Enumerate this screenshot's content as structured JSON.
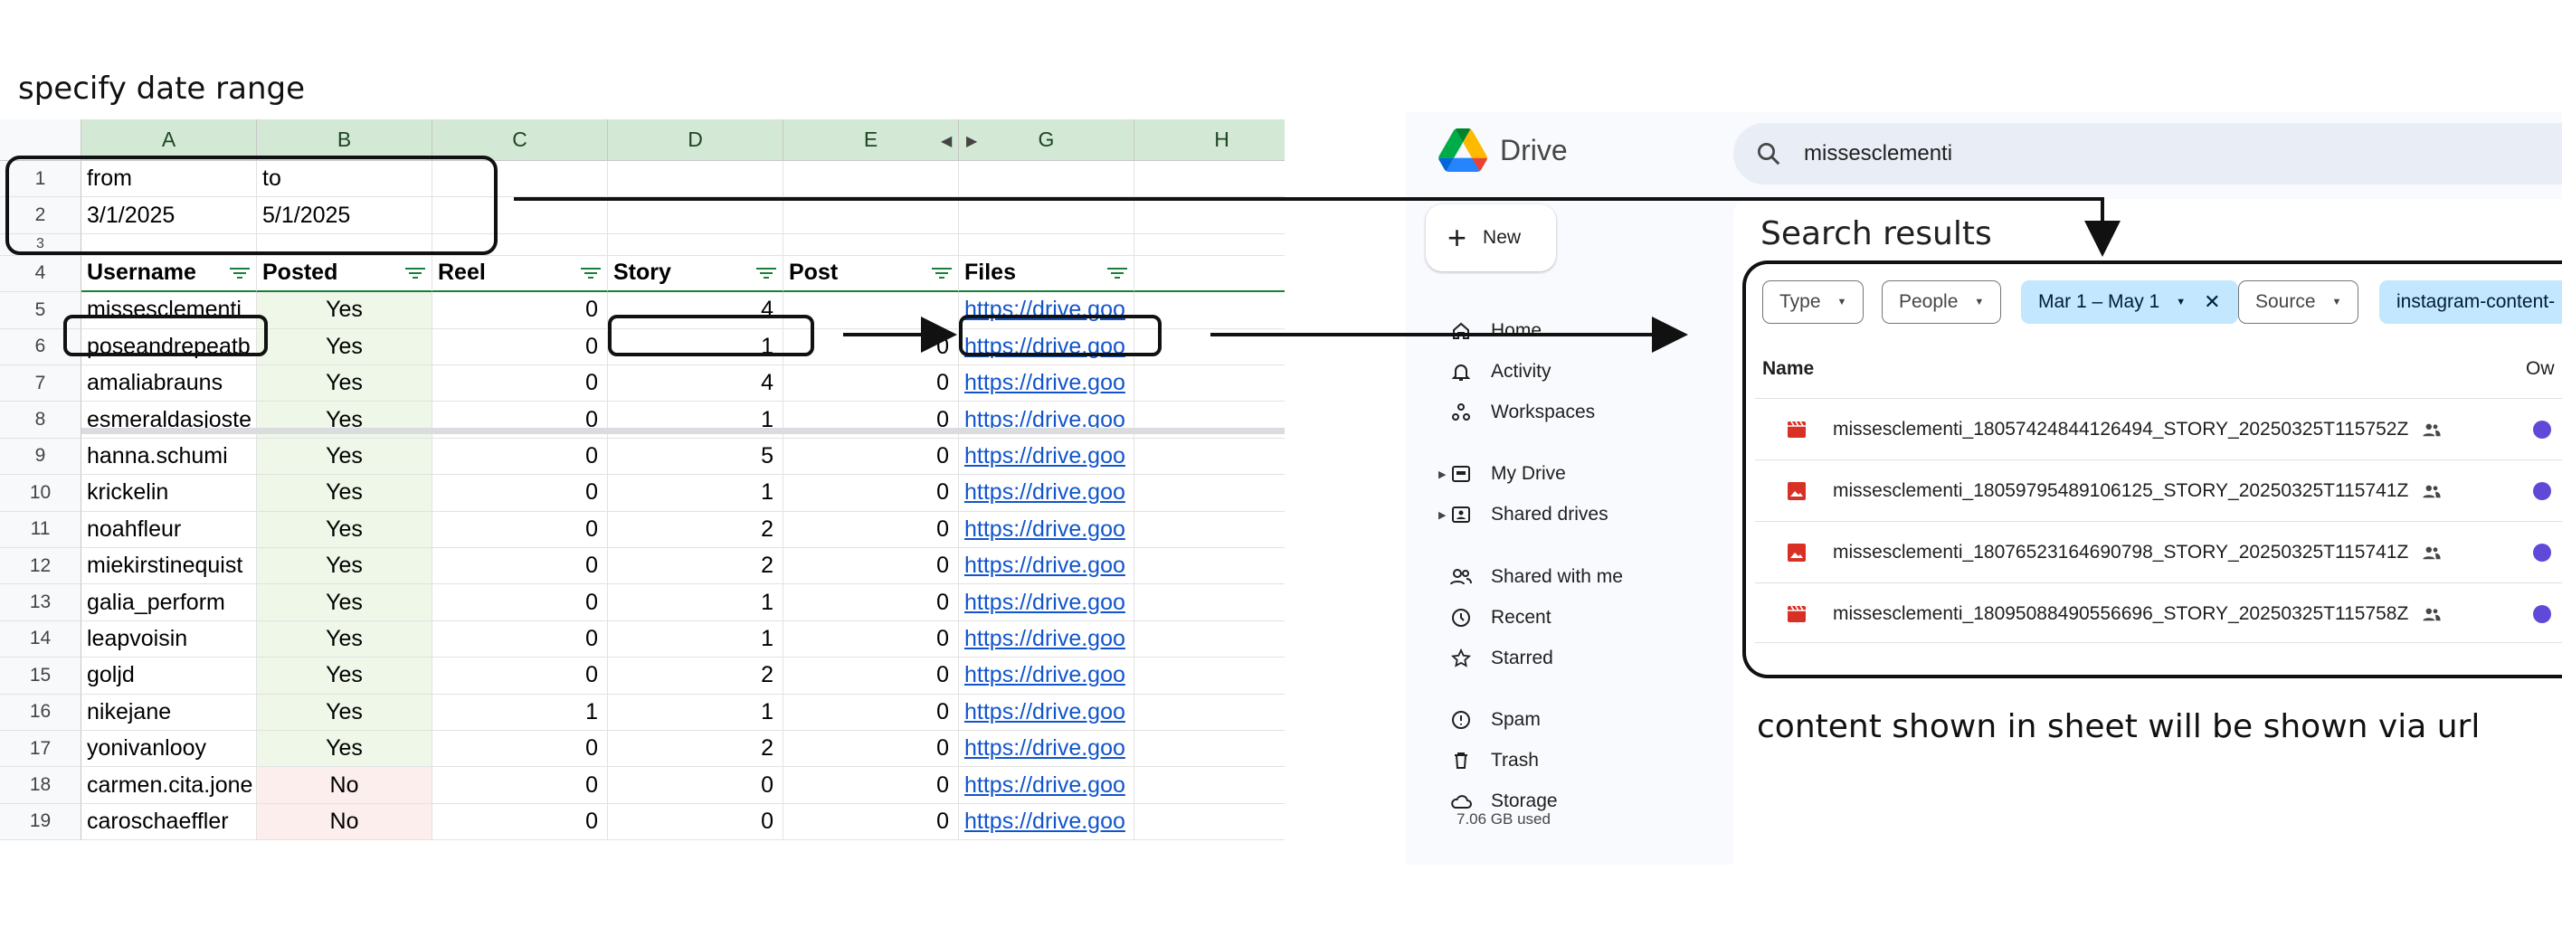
{
  "captions": {
    "top": "specify date range",
    "bottom": "content shown in sheet will be shown via url"
  },
  "sheet": {
    "columns": [
      "A",
      "B",
      "C",
      "D",
      "E",
      "G",
      "H"
    ],
    "rows": [
      {
        "n": "1",
        "a": "from",
        "b": "to",
        "c": "",
        "d": "",
        "e": "",
        "g": ""
      },
      {
        "n": "2",
        "a": "3/1/2025",
        "b": "5/1/2025",
        "c": "",
        "d": "",
        "e": "",
        "g": ""
      },
      {
        "n": "3",
        "a": "",
        "b": "",
        "c": "",
        "d": "",
        "e": "",
        "g": ""
      }
    ],
    "header": {
      "n": "4",
      "a": "Username",
      "b": "Posted",
      "c": "Reel",
      "d": "Story",
      "e": "Post",
      "g": "Files"
    },
    "data": [
      {
        "n": "5",
        "user": "missesclementi",
        "posted": "Yes",
        "reel": "0",
        "story": "4",
        "post": "",
        "files": "https://drive.goo"
      },
      {
        "n": "6",
        "user": "poseandrepeatb",
        "posted": "Yes",
        "reel": "0",
        "story": "1",
        "post": "0",
        "files": "https://drive.goo"
      },
      {
        "n": "7",
        "user": "amaliabrauns",
        "posted": "Yes",
        "reel": "0",
        "story": "4",
        "post": "0",
        "files": "https://drive.goo"
      },
      {
        "n": "8",
        "user": "esmeraldasjoste",
        "posted": "Yes",
        "reel": "0",
        "story": "1",
        "post": "0",
        "files": "https://drive.goo"
      },
      {
        "n": "9",
        "user": "hanna.schumi",
        "posted": "Yes",
        "reel": "0",
        "story": "5",
        "post": "0",
        "files": "https://drive.goo"
      },
      {
        "n": "10",
        "user": "krickelin",
        "posted": "Yes",
        "reel": "0",
        "story": "1",
        "post": "0",
        "files": "https://drive.goo"
      },
      {
        "n": "11",
        "user": "noahfleur",
        "posted": "Yes",
        "reel": "0",
        "story": "2",
        "post": "0",
        "files": "https://drive.goo"
      },
      {
        "n": "12",
        "user": "miekirstinequist",
        "posted": "Yes",
        "reel": "0",
        "story": "2",
        "post": "0",
        "files": "https://drive.goo"
      },
      {
        "n": "13",
        "user": "galia_perform",
        "posted": "Yes",
        "reel": "0",
        "story": "1",
        "post": "0",
        "files": "https://drive.goo"
      },
      {
        "n": "14",
        "user": "leapvoisin",
        "posted": "Yes",
        "reel": "0",
        "story": "1",
        "post": "0",
        "files": "https://drive.goo"
      },
      {
        "n": "15",
        "user": "goljd",
        "posted": "Yes",
        "reel": "0",
        "story": "2",
        "post": "0",
        "files": "https://drive.goo"
      },
      {
        "n": "16",
        "user": "nikejane",
        "posted": "Yes",
        "reel": "1",
        "story": "1",
        "post": "0",
        "files": "https://drive.goo"
      },
      {
        "n": "17",
        "user": "yonivanlooy",
        "posted": "Yes",
        "reel": "0",
        "story": "2",
        "post": "0",
        "files": "https://drive.goo"
      },
      {
        "n": "18",
        "user": "carmen.cita.jone",
        "posted": "No",
        "reel": "0",
        "story": "0",
        "post": "0",
        "files": "https://drive.goo"
      },
      {
        "n": "19",
        "user": "caroschaeffler",
        "posted": "No",
        "reel": "0",
        "story": "0",
        "post": "0",
        "files": "https://drive.goo"
      }
    ]
  },
  "drive": {
    "logo_text": "Drive",
    "search_value": "missesclementi",
    "new_label": "New",
    "nav": [
      {
        "label": "Home",
        "icon": "home-icon"
      },
      {
        "label": "Activity",
        "icon": "bell-icon"
      },
      {
        "label": "Workspaces",
        "icon": "workspaces-icon"
      },
      {
        "label": "My Drive",
        "icon": "my-drive-icon"
      },
      {
        "label": "Shared drives",
        "icon": "shared-drives-icon"
      },
      {
        "label": "Shared with me",
        "icon": "people-icon"
      },
      {
        "label": "Recent",
        "icon": "clock-icon"
      },
      {
        "label": "Starred",
        "icon": "star-icon"
      },
      {
        "label": "Spam",
        "icon": "spam-icon"
      },
      {
        "label": "Trash",
        "icon": "trash-icon"
      },
      {
        "label": "Storage",
        "icon": "cloud-icon"
      }
    ],
    "storage_used": "7.06 GB used",
    "results_title": "Search results",
    "chips": {
      "type": "Type",
      "people": "People",
      "date": "Mar 1 – May 1",
      "source": "Source",
      "folder": "instagram-content-"
    },
    "list_headers": {
      "name": "Name",
      "owner": "Ow"
    },
    "files": [
      {
        "name": "missesclementi_18057424844126494_STORY_20250325T115752Z",
        "kind": "video"
      },
      {
        "name": "missesclementi_18059795489106125_STORY_20250325T115741Z",
        "kind": "image"
      },
      {
        "name": "missesclementi_18076523164690798_STORY_20250325T115741Z",
        "kind": "image"
      },
      {
        "name": "missesclementi_18095088490556696_STORY_20250325T115758Z",
        "kind": "video"
      }
    ],
    "colors": {
      "accent_chip": "#c2e7ff",
      "file_icon": "#d93025",
      "owner": "#5f49d9"
    }
  }
}
